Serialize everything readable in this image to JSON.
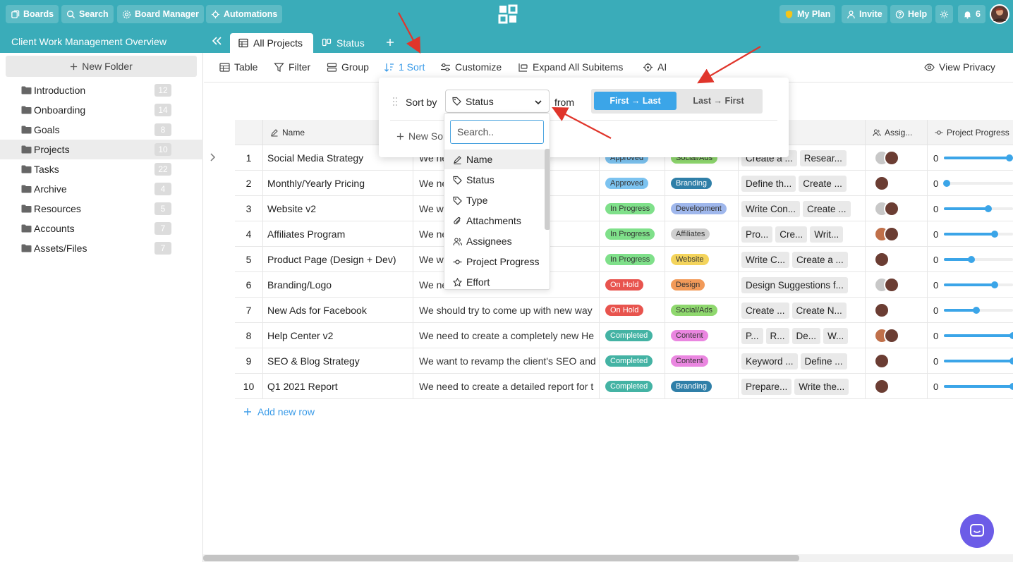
{
  "topbar": {
    "boards": "Boards",
    "search": "Search",
    "board_manager": "Board Manager",
    "automations": "Automations",
    "my_plan": "My Plan",
    "invite": "Invite",
    "help": "Help",
    "notifications_count": "6",
    "accent": "#3aacb9"
  },
  "subbar": {
    "workspace_title": "Client Work Management Overview",
    "tabs": [
      {
        "label": "All Projects",
        "icon": "table-icon"
      },
      {
        "label": "Status",
        "icon": "kanban-icon"
      }
    ]
  },
  "sidebar": {
    "new_folder": "New Folder",
    "folders": [
      {
        "name": "Introduction",
        "count": "12"
      },
      {
        "name": "Onboarding",
        "count": "14"
      },
      {
        "name": "Goals",
        "count": "8"
      },
      {
        "name": "Projects",
        "count": "10"
      },
      {
        "name": "Tasks",
        "count": "22"
      },
      {
        "name": "Archive",
        "count": "4"
      },
      {
        "name": "Resources",
        "count": "5"
      },
      {
        "name": "Accounts",
        "count": "7"
      },
      {
        "name": "Assets/Files",
        "count": "7"
      }
    ]
  },
  "toolbar": {
    "table": "Table",
    "filter": "Filter",
    "group": "Group",
    "sort": "1 Sort",
    "customize": "Customize",
    "expand": "Expand All Subitems",
    "ai": "AI",
    "privacy": "View Privacy"
  },
  "sort_panel": {
    "sort_by": "Sort by",
    "selected": "Status",
    "from": "from",
    "first_last": "First → Last",
    "last_first": "Last → First",
    "new_sort": "New Sort"
  },
  "dropdown": {
    "search_placeholder": "Search..",
    "items": [
      {
        "label": "Name",
        "icon": "pencil-icon"
      },
      {
        "label": "Status",
        "icon": "tag-icon"
      },
      {
        "label": "Type",
        "icon": "tag-icon"
      },
      {
        "label": "Attachments",
        "icon": "paperclip-icon"
      },
      {
        "label": "Assignees",
        "icon": "users-icon"
      },
      {
        "label": "Project Progress",
        "icon": "progress-icon"
      },
      {
        "label": "Effort",
        "icon": "star-icon"
      }
    ]
  },
  "table": {
    "headers": {
      "name": "Name",
      "assignees": "Assig...",
      "progress": "Project Progress"
    },
    "rows": [
      {
        "num": "1",
        "name": "Social Media Strategy",
        "desc": "We ne...s social me",
        "status": "Approved",
        "status_color": "#7cc3f0",
        "type": "Social/Ads",
        "type_color": "#8fd86e",
        "subitems": [
          "Create a ...",
          "Resear..."
        ],
        "progress": 0.95,
        "progress_label": "0"
      },
      {
        "num": "2",
        "name": "Monthly/Yearly Pricing",
        "desc": "We ne...nthly/yearly p",
        "status": "Approved",
        "status_color": "#7cc3f0",
        "type": "Branding",
        "type_color": "#2f7fa8",
        "subitems": [
          "Define th...",
          "Create ..."
        ],
        "progress": 0.04,
        "progress_label": "0"
      },
      {
        "num": "3",
        "name": "Website v2",
        "desc": "We wa...version of t",
        "status": "In Progress",
        "status_color": "#7fe08a",
        "type": "Development",
        "type_color": "#9fb7ec",
        "subitems": [
          "Write Con...",
          "Create ..."
        ],
        "progress": 0.64,
        "progress_label": "0"
      },
      {
        "num": "4",
        "name": "Affiliates Program",
        "desc": "We ne...tes program",
        "status": "In Progress",
        "status_color": "#7fe08a",
        "type": "Affiliates",
        "type_color": "#cfcfcf",
        "subitems": [
          "Pro...",
          "Cre...",
          "Writ..."
        ],
        "progress": 0.73,
        "progress_label": "0"
      },
      {
        "num": "5",
        "name": "Product Page (Design + Dev)",
        "desc": "We wa... Product Pa",
        "status": "In Progress",
        "status_color": "#7fe08a",
        "type": "Website",
        "type_color": "#f4d45c",
        "subitems": [
          "Write C...",
          "Create a ..."
        ],
        "progress": 0.4,
        "progress_label": "0"
      },
      {
        "num": "6",
        "name": "Branding/Logo",
        "desc": "We ne...d create a n",
        "status": "On Hold",
        "status_color": "#e8544e",
        "type": "Design",
        "type_color": "#f29a59",
        "subitems": [
          "Design Suggestions f..."
        ],
        "progress": 0.73,
        "progress_label": "0"
      },
      {
        "num": "7",
        "name": "New Ads for Facebook",
        "desc": "We should try to come up with new way",
        "status": "On Hold",
        "status_color": "#e8544e",
        "type": "Social/Ads",
        "type_color": "#8fd86e",
        "subitems": [
          "Create ...",
          "Create N..."
        ],
        "progress": 0.47,
        "progress_label": "0"
      },
      {
        "num": "8",
        "name": "Help Center v2",
        "desc": "We need to create a completely new He",
        "status": "Completed",
        "status_color": "#44b3a4",
        "type": "Content",
        "type_color": "#ea86e0",
        "subitems": [
          "P...",
          "R...",
          "De...",
          "W..."
        ],
        "progress": 1.0,
        "progress_label": "0"
      },
      {
        "num": "9",
        "name": "SEO & Blog Strategy",
        "desc": "We want to revamp the client's SEO and",
        "status": "Completed",
        "status_color": "#44b3a4",
        "type": "Content",
        "type_color": "#ea86e0",
        "subitems": [
          "Keyword ...",
          "Define ..."
        ],
        "progress": 1.0,
        "progress_label": "0"
      },
      {
        "num": "10",
        "name": "Q1 2021 Report",
        "desc": "We need to create a detailed report for t",
        "status": "Completed",
        "status_color": "#44b3a4",
        "type": "Branding",
        "type_color": "#2f7fa8",
        "subitems": [
          "Prepare...",
          "Write the..."
        ],
        "progress": 1.0,
        "progress_label": "0"
      }
    ],
    "add_row": "Add new row"
  }
}
